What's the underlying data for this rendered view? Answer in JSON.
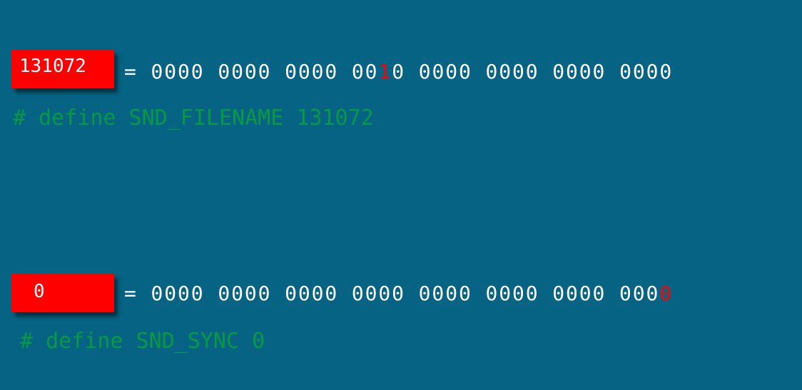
{
  "rows": [
    {
      "value_label": "131072",
      "equals": "=",
      "binary_before": "0000 0000 0000 00",
      "binary_highlight": "1",
      "binary_after": "0 0000 0000 0000 0000",
      "define_line": "# define SND_FILENAME 131072"
    },
    {
      "value_label": "0",
      "equals": "=",
      "binary_before": "0000 0000 0000 0000 0000 0000 0000 000",
      "binary_highlight": "0",
      "binary_after": "",
      "define_line": "# define SND_SYNC 0"
    }
  ],
  "colors": {
    "background": "#066383",
    "value_box": "#ff0000",
    "highlight_bit": "#ff0000",
    "code_text": "#079944",
    "binary_text": "#ffffff"
  }
}
